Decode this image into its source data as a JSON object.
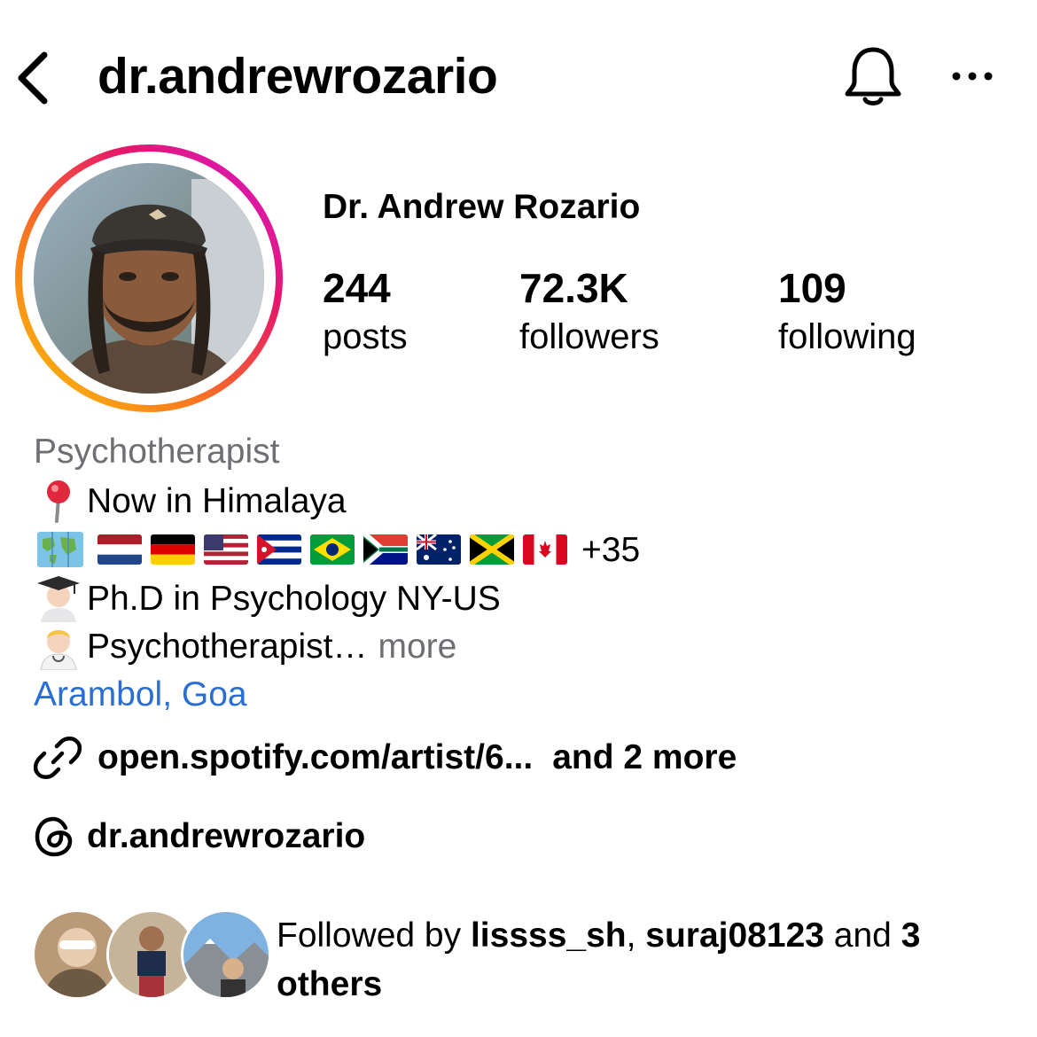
{
  "header": {
    "username": "dr.andrewrozario",
    "back_icon": "chevron-left-icon",
    "bell_icon": "bell-icon",
    "more_icon": "more-horizontal-icon"
  },
  "profile": {
    "display_name": "Dr. Andrew Rozario",
    "story_ring_colors": [
      "#fdc30a",
      "#f7771e",
      "#e7166b",
      "#d21ad6"
    ],
    "stats": [
      {
        "value": "244",
        "label": "posts"
      },
      {
        "value": "72.3K",
        "label": "followers"
      },
      {
        "value": "109",
        "label": "following"
      }
    ]
  },
  "bio": {
    "category": "Psychotherapist",
    "lines": [
      {
        "icon": "round-pushpin-icon",
        "text": "Now in Himalaya"
      },
      {
        "icon": "world-map-icon",
        "flags": [
          "netherlands",
          "germany",
          "united-states",
          "cuba",
          "brazil",
          "south-africa",
          "australia",
          "jamaica",
          "canada"
        ],
        "text": "+35"
      },
      {
        "icon": "student-icon",
        "text": "Ph.D in Psychology NY-US"
      },
      {
        "icon": "health-worker-icon",
        "text": "Psychotherapist…",
        "more": "more"
      }
    ],
    "location": "Arambol, Goa",
    "location_color": "#2a6ed5"
  },
  "links": {
    "link_icon": "link-icon",
    "url": "open.spotify.com/artist/6...",
    "extra": "and 2 more"
  },
  "threads": {
    "icon": "threads-icon",
    "handle": "dr.andrewrozario"
  },
  "followed_by": {
    "prefix": "Followed by",
    "user1": "lissss_sh",
    "separator": ",",
    "user2": "suraj08123",
    "conj": "and",
    "others": "3 others"
  }
}
